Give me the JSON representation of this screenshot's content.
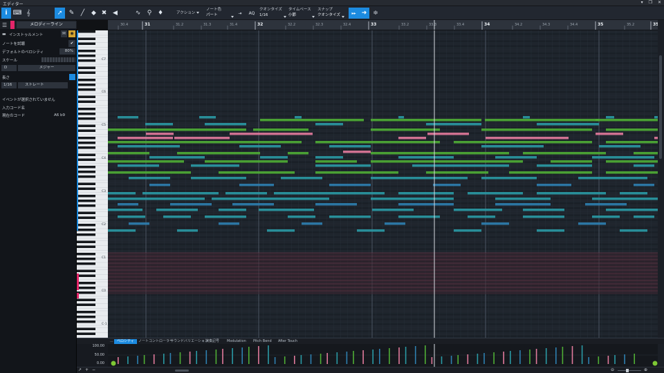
{
  "window": {
    "title": "エディター"
  },
  "toolbar": {
    "action_label": "アクション",
    "note_color_label": "ノート色",
    "note_color_value": "パート",
    "aq_label": "AQ",
    "quantize_label": "クオンタイズ",
    "quantize_value": "1/16",
    "timebase_label": "タイムベース",
    "timebase_value": "小節",
    "snap_label": "スナップ",
    "snap_value": "クオンタイズ"
  },
  "inspector": {
    "track_name": "メロディーライン",
    "instrument_label": "インストゥルメント",
    "mute_label": "M",
    "audition_label": "ノートを試聴",
    "velocity_label": "デフォルトのベロシティ",
    "velocity_value": "80%",
    "scale_label": "スケール",
    "scale_root": "D",
    "scale_type": "メジャー",
    "length_label": "長さ",
    "length_value": "1/16",
    "length_type": "ストレート",
    "no_event": "イベントが選択されていません",
    "input_chord_label": "入力コード名",
    "current_chord_label": "現在のコード",
    "current_chord_value": "A6 b9"
  },
  "ruler": {
    "ticks": [
      "30.4",
      "31",
      "31.2",
      "31.3",
      "31.4",
      "32",
      "32.2",
      "32.3",
      "32.4",
      "33",
      "33.2",
      "33.3",
      "33.4",
      "34",
      "34.2",
      "34.3",
      "34.4",
      "35",
      "35.2",
      "35"
    ]
  },
  "keyboard": {
    "octave_labels": [
      "C7",
      "C6",
      "C5",
      "C4",
      "C3",
      "C2",
      "C1",
      "C0",
      "C-1"
    ]
  },
  "lower_panel": {
    "more_label": "...",
    "tabs": [
      "ベロシティ",
      "ノートコントローラー",
      "サウンドバリエーション",
      "演奏記号",
      "Modulation",
      "Pitch Bend",
      "After Touch"
    ],
    "scale_labels": [
      "100.00",
      "50.00",
      "0.00"
    ]
  },
  "colors": {
    "accent": "#1c8be0",
    "track_color": "#e5266a",
    "note_pink": "#e27a9c",
    "note_green": "#4fae35",
    "note_teal": "#2a9aa5",
    "note_blue": "#2e80b0"
  }
}
